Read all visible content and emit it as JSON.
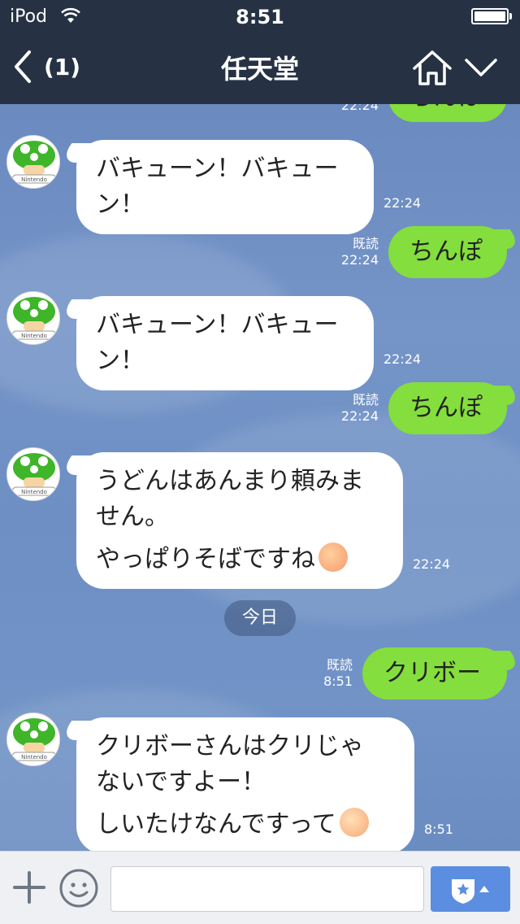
{
  "status_bar": {
    "carrier": "iPod",
    "time": "8:51"
  },
  "header": {
    "back_count": "(1)",
    "title": "任天堂"
  },
  "messages": [
    {
      "dir": "out",
      "text": "ちんぽ",
      "time": "22:24"
    },
    {
      "dir": "in",
      "lines": [
        "バキューン！バキュー",
        "ン！"
      ],
      "time": "22:24"
    },
    {
      "dir": "out",
      "text": "ちんぽ",
      "read": "既読",
      "time": "22:24"
    },
    {
      "dir": "in",
      "lines": [
        "バキューン！バキュー",
        "ン！"
      ],
      "time": "22:24"
    },
    {
      "dir": "out",
      "text": "ちんぽ",
      "read": "既読",
      "time": "22:24"
    },
    {
      "dir": "in",
      "lines": [
        "うどんはあんまり頼みま",
        "せん。",
        "やっぱりそばですね"
      ],
      "emoji": "kiss-face",
      "time": "22:24"
    },
    {
      "dir": "out",
      "text": "クリボー",
      "read": "既読",
      "time": "8:51"
    },
    {
      "dir": "in",
      "lines": [
        "クリボーさんはクリじゃ",
        "ないですよー！",
        "しいたけなんですって"
      ],
      "emoji": "smile-face",
      "time": "8:51"
    }
  ],
  "date_divider": "今日",
  "avatar_logo": "Nintendo",
  "input": {
    "placeholder": ""
  },
  "colors": {
    "header": "#263244",
    "outgoing": "#84de3d",
    "incoming": "#ffffff",
    "chat_bg": "#6f8fc0"
  }
}
